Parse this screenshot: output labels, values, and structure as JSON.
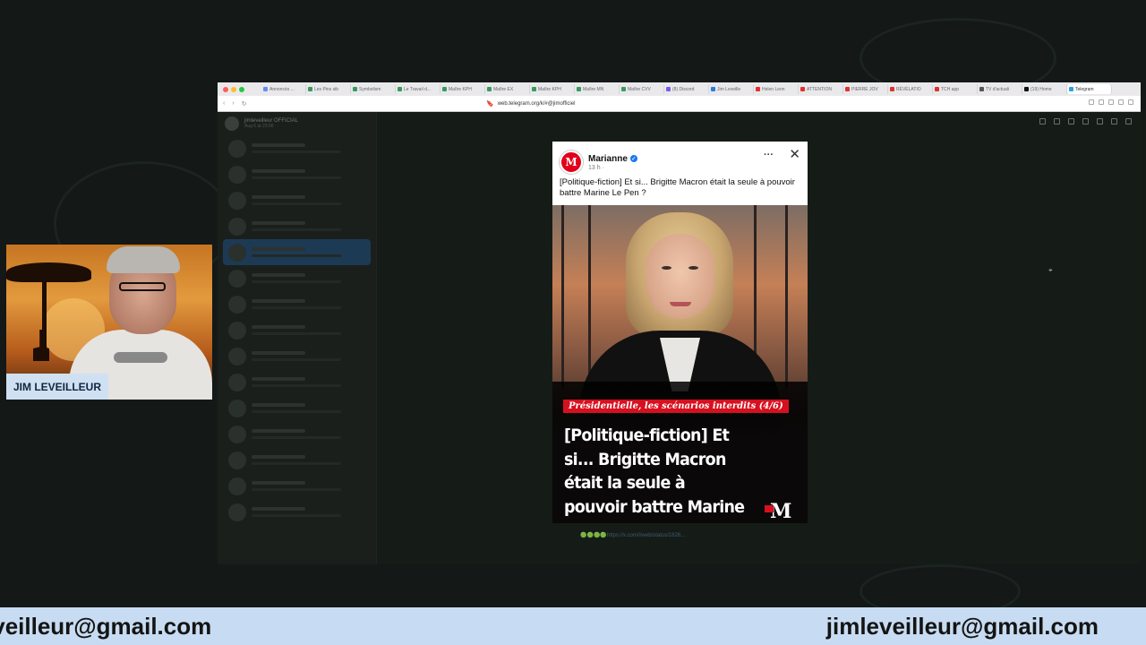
{
  "browser": {
    "tabs": [
      {
        "label": "Annoncés ...",
        "color": "#6b8af0"
      },
      {
        "label": "Les Pins sib",
        "color": "#3b9a5b"
      },
      {
        "label": "Symbolism",
        "color": "#3b9a5b"
      },
      {
        "label": "Le Travail d...",
        "color": "#3b9a5b"
      },
      {
        "label": "Maître KPH",
        "color": "#3b9a5b"
      },
      {
        "label": "Maître EX",
        "color": "#3b9a5b"
      },
      {
        "label": "Maître KPH",
        "color": "#3b9a5b"
      },
      {
        "label": "Maître MN",
        "color": "#3b9a5b"
      },
      {
        "label": "Maître CVV",
        "color": "#3b9a5b"
      },
      {
        "label": "(8) Discord",
        "color": "#7a5af0"
      },
      {
        "label": "Jim Leveille",
        "color": "#2a7de1"
      },
      {
        "label": "Helen Leon",
        "color": "#e03030"
      },
      {
        "label": "ATTENTION",
        "color": "#e03030"
      },
      {
        "label": "PIERRE JOV",
        "color": "#e03030"
      },
      {
        "label": "RÉVÉLATIO",
        "color": "#e03030"
      },
      {
        "label": "TCH app",
        "color": "#e03030"
      },
      {
        "label": "TV d'actuali",
        "color": "#555555"
      },
      {
        "label": "(19) Home",
        "color": "#111111"
      },
      {
        "label": "Telegram",
        "color": "#2aa3e0"
      }
    ],
    "url": "web.telegram.org/k/#@jimofficiel"
  },
  "telegram": {
    "channel_name": "jimleveilleur OFFICIAL",
    "channel_sub": "Aug 6 at 23:56"
  },
  "post": {
    "page_name": "Marianne",
    "time": "13 h ·",
    "text": "[Politique-fiction] Et si... Brigitte Macron était la seule à pouvoir battre Marine Le Pen ?",
    "image_tag": "Présidentielle, les scénarios interdits (4/6)",
    "image_headline": "[Politique-fiction] Et si... Brigitte Macron était la seule à pouvoir battre Marine Le Pen ?",
    "more_label": "···",
    "close_label": "✕"
  },
  "caption_link": "🟢🟢🟢🟢https://x.com/i/web/status/1826...",
  "webcam": {
    "name": "JIM LEVEILLEUR"
  },
  "banner": {
    "email_left": "jimleveilleur@gmail.com",
    "email_right": "jimleveilleur@gmail.com"
  }
}
